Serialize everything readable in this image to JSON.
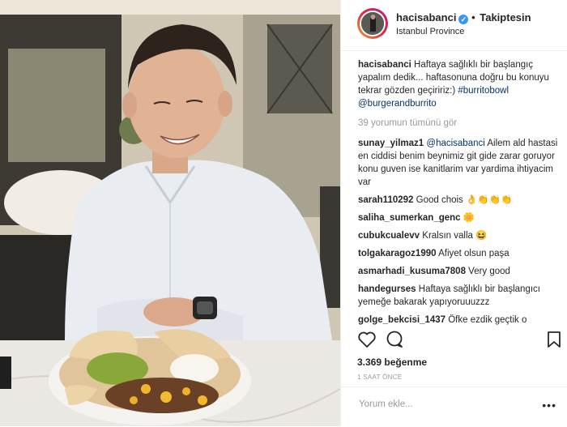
{
  "post": {
    "username": "hacisabanci",
    "follow_sep": "•",
    "follow_label": "Takiptesin",
    "location": "Istanbul Province",
    "caption_user": "hacisabanci",
    "caption_text": " Haftaya sağlıklı bir başlangıç yapalım dedik... haftasonuna doğru bu konuyu tekrar gözden geçiririz:) ",
    "tag1": "#burritobowl",
    "tag2": "@burgerandburrito",
    "view_all": "39 yorumun tümünü gör",
    "likes": "3.369 beğenme",
    "time": "1 SAAT ÖNCE",
    "add_comment_placeholder": "Yorum ekle...",
    "more_glyph": "•••"
  },
  "comments": [
    {
      "user": "sunay_yilmaz1",
      "mention": "@hacisabanci",
      "text": " Ailem ald hastasi en ciddisi benim beynimiz git gide zarar goruyor konu guven ise kanitlarim var yardima ihtiyacim var"
    },
    {
      "user": "sarah110292",
      "mention": "",
      "text": " Good chois 👌👏👏👏"
    },
    {
      "user": "saliha_sumerkan_genc",
      "mention": "",
      "text": " 🌼"
    },
    {
      "user": "cubukcualevv",
      "mention": "",
      "text": " Kralsın valla 😆"
    },
    {
      "user": "tolgakaragoz1990",
      "mention": "",
      "text": " Afiyet olsun paşa"
    },
    {
      "user": "asmarhadi_kusuma7808",
      "mention": "",
      "text": " Very good"
    },
    {
      "user": "handegurses",
      "mention": "",
      "text": " Haftaya sağlıklı bir başlangıcı yemeğe bakarak yapıyoruuuzzz"
    },
    {
      "user": "golge_bekcisi_1437",
      "mention": "",
      "text": " Öfke ezdik geçtik o"
    }
  ],
  "icons": {
    "verified": "check-badge",
    "like": "heart-outline",
    "comment": "speech-bubble",
    "save": "bookmark-outline"
  },
  "colors": {
    "link": "#003569",
    "verified": "#3897f0",
    "muted": "#999999"
  }
}
